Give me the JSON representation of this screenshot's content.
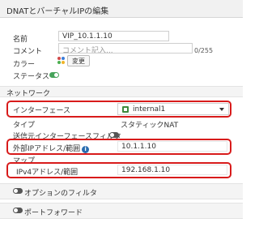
{
  "header": {
    "title": "DNATとバーチャルIPの編集"
  },
  "general": {
    "name_label": "名前",
    "name_value": "VIP_10.1.1.10",
    "comment_label": "コメント",
    "comment_placeholder": "コメント記入...",
    "comment_counter": "0/255",
    "color_label": "カラー",
    "color_button": "変更",
    "status_label": "ステータス",
    "status_on": true
  },
  "network": {
    "section_title": "ネットワーク",
    "interface_label": "インターフェース",
    "interface_value": "internal1",
    "type_label": "タイプ",
    "type_value": "スタティックNAT",
    "source_filter_label": "送信元インターフェースフィルタ",
    "source_filter_on": false,
    "external_ip_label": "外部IPアドレス/範囲",
    "external_ip_value": "10.1.1.10"
  },
  "map": {
    "section_title": "マップ",
    "ipv4_label": "IPv4アドレス/範囲",
    "ipv4_value": "192.168.1.10"
  },
  "options": {
    "option_filter_label": "オプションのフィルタ",
    "option_filter_on": false,
    "port_forward_label": "ポートフォワード",
    "port_forward_on": false
  },
  "colors": {
    "highlight": "#d81b1b",
    "toggle_on": "#46a35a",
    "toggle_off": "#555555"
  }
}
